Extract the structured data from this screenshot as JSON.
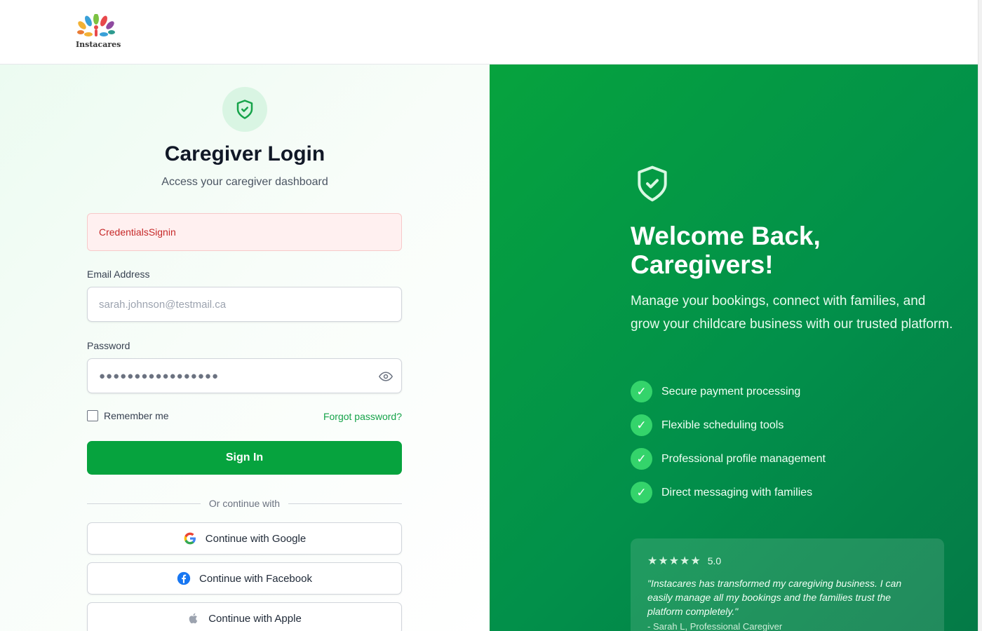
{
  "brand": {
    "name": "Instacares"
  },
  "login": {
    "title": "Caregiver Login",
    "subtitle": "Access your caregiver dashboard",
    "error": "CredentialsSignin",
    "email_label": "Email Address",
    "email_placeholder": "sarah.johnson@testmail.ca",
    "password_label": "Password",
    "password_value": "●●●●●●●●●●●●●●●●●",
    "remember_label": "Remember me",
    "forgot_label": "Forgot password?",
    "signin_label": "Sign In",
    "divider_label": "Or continue with",
    "social": [
      {
        "label": "Continue with Google",
        "icon": "google-icon"
      },
      {
        "label": "Continue with Facebook",
        "icon": "facebook-icon"
      },
      {
        "label": "Continue with Apple",
        "icon": "apple-icon"
      }
    ]
  },
  "hero": {
    "heading_line1": "Welcome Back,",
    "heading_line2": "Caregivers!",
    "lead": "Manage your bookings, connect with families, and grow your childcare business with our trusted platform.",
    "features": [
      "Secure payment processing",
      "Flexible scheduling tools",
      "Professional profile management",
      "Direct messaging with families"
    ],
    "testimonial": {
      "rating": "5.0",
      "quote": "\"Instacares has transformed my caregiving business. I can easily manage all my bookings and the families trust the platform completely.\"",
      "author": "- Sarah L, Professional Caregiver"
    }
  },
  "colors": {
    "primary": "#06a33e",
    "error_bg": "#fff0f0",
    "error_text": "#c62828"
  }
}
